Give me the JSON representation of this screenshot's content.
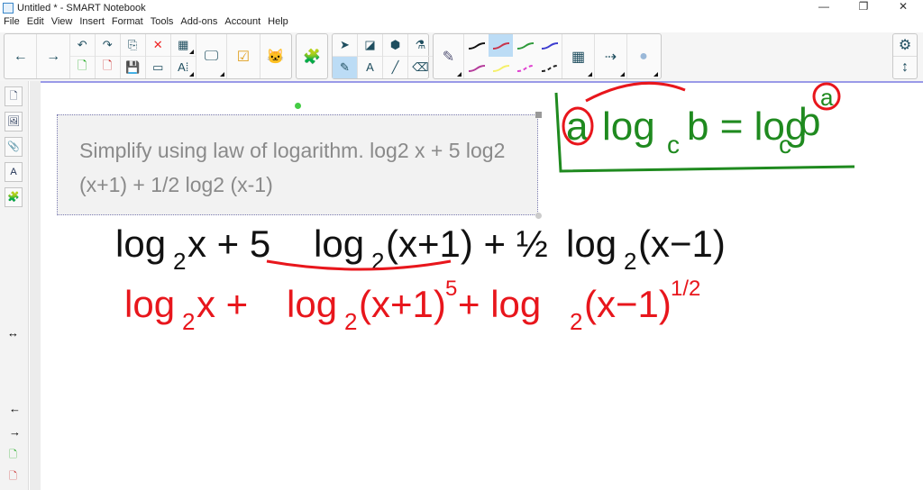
{
  "window": {
    "title": "Untitled * - SMART Notebook",
    "minimize": "—",
    "restore": "❐",
    "close": "✕"
  },
  "menu": [
    "File",
    "Edit",
    "View",
    "Insert",
    "Format",
    "Tools",
    "Add-ons",
    "Account",
    "Help"
  ],
  "toolbar": {
    "back": "←",
    "forward": "→",
    "undo": "↶",
    "redo": "↷",
    "paste": "⎘",
    "delete": "✕",
    "table": "▦",
    "add_page": "🗋",
    "delete_page": "🗋",
    "save": "💾",
    "screen": "▭",
    "text_tools": "A⁞",
    "capture": "🖵",
    "response": "☑",
    "addon": "🐱",
    "gallery": "🧩",
    "select": "➤",
    "shapes": "◪",
    "fill": "⬢",
    "magic": "⚗",
    "pens": "✎",
    "text": "A",
    "line": "╱",
    "eraser": "⌫",
    "pen": "✎",
    "colors": "▦",
    "line_style": "⇢",
    "effects": "●",
    "settings": "⚙",
    "move": "↕"
  },
  "pen_colors": [
    "#111111",
    "#c8334a",
    "#2e9a3a",
    "#3c3ccf",
    "#b43a9a",
    "#f5f06a",
    "#e040d0",
    "#222222"
  ],
  "side_tabs": [
    "🗋",
    "🖼",
    "📎",
    "A",
    "🧩"
  ],
  "side_bottom": [
    "↔",
    "←",
    "→",
    "🗋",
    "🗋"
  ],
  "question": "Simplify using law of logarithm. log2 x + 5 log2 (x+1) + 1/2 log2 (x-1)",
  "handwriting": {
    "rule_left": "a",
    "rule_mid": "log",
    "rule_sub": "c",
    "rule_b": "b = log",
    "rule_sub2": "c",
    "rule_b2": "b",
    "rule_exp": "a",
    "line1": [
      {
        "t": "log",
        "s": "2",
        "r": " x + 5 "
      },
      {
        "t": "log",
        "s": "2",
        "r": "(x+1) + ½ "
      },
      {
        "t": "log",
        "s": "2",
        "r": "(x−1)"
      }
    ],
    "line2": [
      {
        "t": "log",
        "s": "2",
        "r": " x + "
      },
      {
        "t": "log",
        "s": "2",
        "r": "(x+1)",
        "e": "5"
      },
      {
        "t": " + log",
        "s": "2",
        "r": "(x−1)",
        "e": "1/2"
      }
    ],
    "colors": {
      "black": "#111111",
      "red": "#e8161c",
      "green": "#1f8a1f"
    }
  }
}
